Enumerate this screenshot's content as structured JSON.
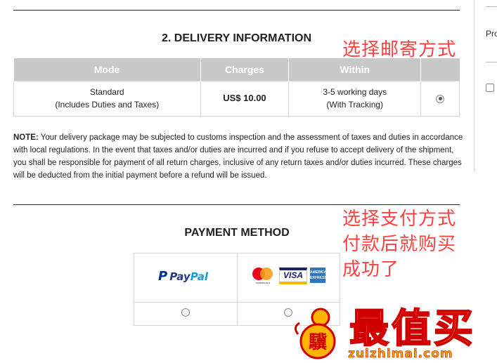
{
  "delivery": {
    "title": "2. DELIVERY INFORMATION",
    "headers": [
      "Mode",
      "Charges",
      "Within",
      ""
    ],
    "row": {
      "mode": "Standard",
      "mode_note": "(Includes Duties and Taxes)",
      "charges": "US$ 10.00",
      "within": "3-5 working days",
      "within_note": "(With Tracking)",
      "selected": true
    }
  },
  "note": {
    "label": "NOTE:",
    "text": "Your delivery package may be subjected to customs inspection and the assessment of taxes and duties in accordance with local regulations. In the event that taxes and/or duties are incurred and if you refuse to accept delivery of the shipment, you shall be responsible for payment of all return charges, inclusive of any return taxes and/or duties incurred. These charges will be deducted from the initial payment before a refund will be issued."
  },
  "payment": {
    "title": "PAYMENT METHOD",
    "options": [
      {
        "name": "PayPal",
        "icon": "paypal-logo",
        "selected": false
      },
      {
        "name": "Cards",
        "icons": [
          "mastercard-logo",
          "visa-logo",
          "amex-logo"
        ],
        "mastercard_label": "mastercard",
        "visa_label": "VISA",
        "amex_label": "AMERICAN EXPRESS",
        "selected": false
      }
    ]
  },
  "side_panel": {
    "label": "Pro"
  },
  "annotations": {
    "delivery": "选择邮寄方式",
    "payment_line1": "选择支付方式",
    "payment_line2": "付款后就购买",
    "payment_line3": "成功了"
  },
  "watermark": {
    "brand": "最值买",
    "url": "zuizhimai.com",
    "logo_glyph": "驥"
  },
  "colors": {
    "header_bg": "#c8c8c8",
    "annotation": "#ff4040",
    "watermark_fill": "#ffb400",
    "watermark_stroke": "#d00000"
  }
}
